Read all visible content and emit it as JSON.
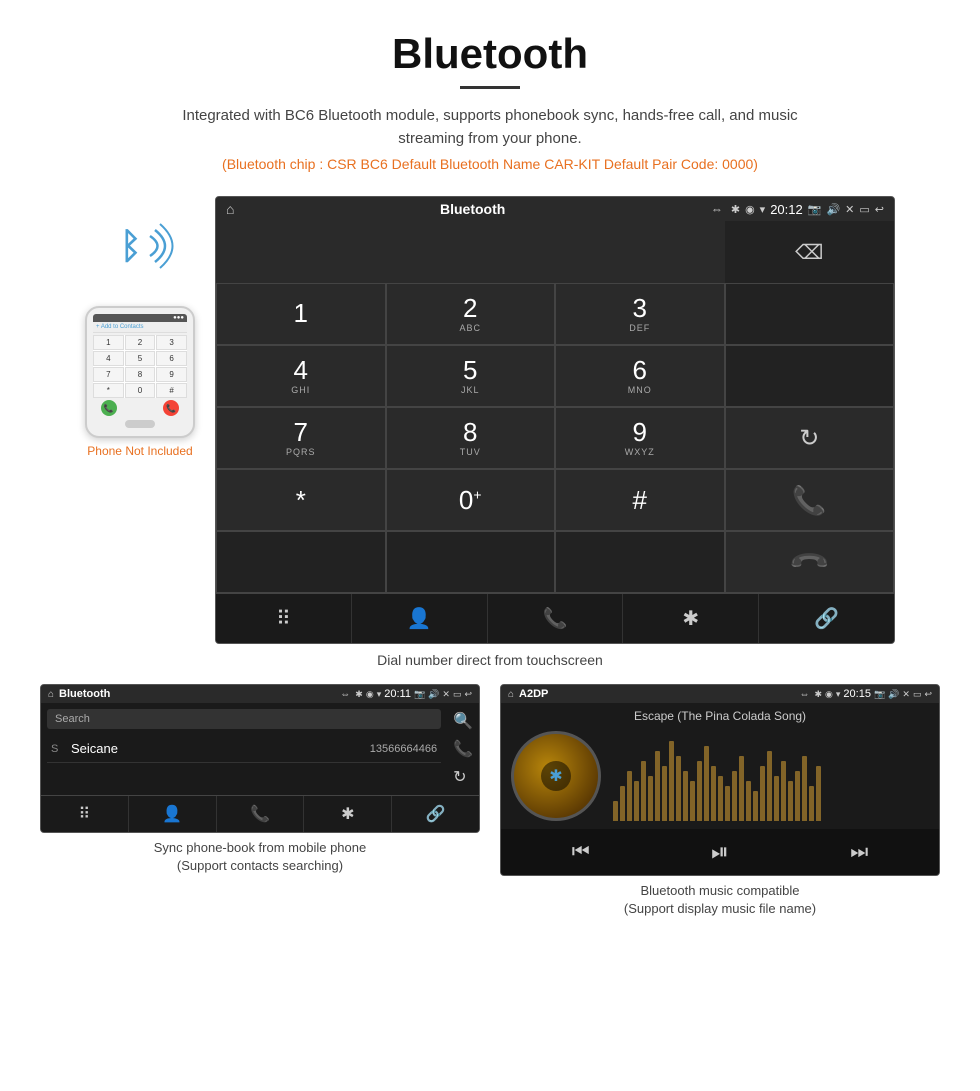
{
  "page": {
    "title": "Bluetooth",
    "description": "Integrated with BC6 Bluetooth module, supports phonebook sync, hands-free call, and music streaming from your phone.",
    "specs": "(Bluetooth chip : CSR BC6    Default Bluetooth Name CAR-KIT    Default Pair Code: 0000)",
    "dial_caption": "Dial number direct from touchscreen"
  },
  "phone_illustration": {
    "not_included_label": "Phone Not Included",
    "add_to_contacts": "+ Add to Contacts",
    "keys": [
      "1",
      "2",
      "3",
      "4",
      "5",
      "6",
      "7",
      "8",
      "9",
      "*",
      "0",
      "#"
    ]
  },
  "car_dial_screen": {
    "title": "Bluetooth",
    "time": "20:12",
    "usb_icon": "⇔",
    "keys": [
      {
        "num": "1",
        "letters": ""
      },
      {
        "num": "2",
        "letters": "ABC"
      },
      {
        "num": "3",
        "letters": "DEF"
      },
      {
        "num": "4",
        "letters": "GHI"
      },
      {
        "num": "5",
        "letters": "JKL"
      },
      {
        "num": "6",
        "letters": "MNO"
      },
      {
        "num": "7",
        "letters": "PQRS"
      },
      {
        "num": "8",
        "letters": "TUV"
      },
      {
        "num": "9",
        "letters": "WXYZ"
      },
      {
        "num": "*",
        "letters": ""
      },
      {
        "num": "0",
        "letters": "+"
      },
      {
        "num": "#",
        "letters": ""
      }
    ],
    "nav_icons": [
      "⠿",
      "👤",
      "📞",
      "✱",
      "🔗"
    ]
  },
  "phonebook_screen": {
    "title": "Bluetooth",
    "time": "20:11",
    "search_placeholder": "Search",
    "contacts": [
      {
        "letter": "S",
        "name": "Seicane",
        "number": "13566664466"
      }
    ],
    "nav_icons": [
      "⠿",
      "👤",
      "📞",
      "✱",
      "🔗"
    ],
    "caption": "Sync phone-book from mobile phone\n(Support contacts searching)"
  },
  "music_screen": {
    "title": "A2DP",
    "time": "20:15",
    "song_title": "Escape (The Pina Colada Song)",
    "caption": "Bluetooth music compatible\n(Support display music file name)",
    "viz_heights": [
      20,
      35,
      50,
      40,
      60,
      45,
      70,
      55,
      80,
      65,
      50,
      40,
      60,
      75,
      55,
      45,
      35,
      50,
      65,
      40,
      30,
      55,
      70,
      45,
      60,
      40,
      50,
      65,
      35,
      55
    ]
  },
  "colors": {
    "orange": "#e87020",
    "green": "#4caf50",
    "red": "#f44336",
    "blue": "#4a9fd4"
  }
}
